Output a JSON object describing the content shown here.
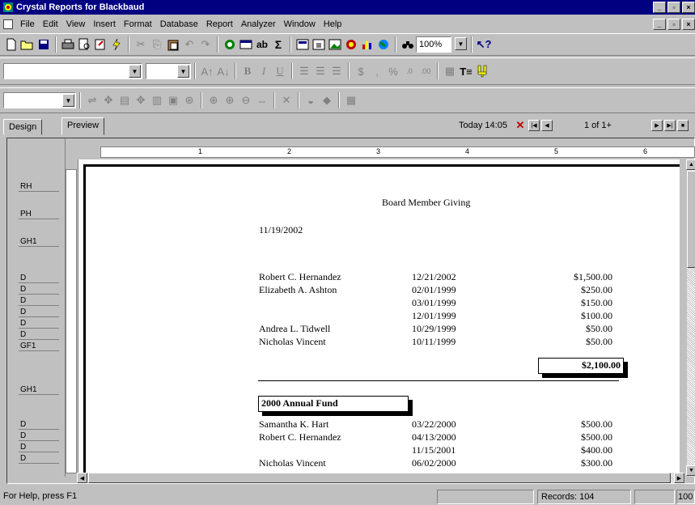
{
  "window": {
    "title": "Crystal Reports for Blackbaud",
    "min": "_",
    "max": "▫",
    "close": "×"
  },
  "menu": [
    "File",
    "Edit",
    "View",
    "Insert",
    "Format",
    "Database",
    "Report",
    "Analyzer",
    "Window",
    "Help"
  ],
  "toolbar1": {
    "zoom_value": "100%"
  },
  "tabs": {
    "design": "Design",
    "preview": "Preview"
  },
  "nav": {
    "today": "Today 14:05",
    "page": "1 of 1+"
  },
  "sections": [
    "RH",
    "PH",
    "GH1",
    "D",
    "D",
    "D",
    "D",
    "D",
    "D",
    "GF1",
    "GH1",
    "D",
    "D",
    "D",
    "D"
  ],
  "ruler_marks": [
    "1",
    "2",
    "3",
    "4",
    "5",
    "6"
  ],
  "report": {
    "title": "Board Member Giving",
    "date": "11/19/2002",
    "group1_rows": [
      {
        "name": "Robert C. Hernandez",
        "date": "12/21/2002",
        "amount": "$1,500.00"
      },
      {
        "name": "Elizabeth A. Ashton",
        "date": "02/01/1999",
        "amount": "$250.00"
      },
      {
        "name": "",
        "date": "03/01/1999",
        "amount": "$150.00"
      },
      {
        "name": "",
        "date": "12/01/1999",
        "amount": "$100.00"
      },
      {
        "name": "Andrea L. Tidwell",
        "date": "10/29/1999",
        "amount": "$50.00"
      },
      {
        "name": "Nicholas Vincent",
        "date": "10/11/1999",
        "amount": "$50.00"
      }
    ],
    "group1_total": "$2,100.00",
    "group2_title": "2000 Annual Fund",
    "group2_rows": [
      {
        "name": "Samantha K. Hart",
        "date": "03/22/2000",
        "amount": "$500.00"
      },
      {
        "name": "Robert C. Hernandez",
        "date": "04/13/2000",
        "amount": "$500.00"
      },
      {
        "name": "",
        "date": "11/15/2001",
        "amount": "$400.00"
      },
      {
        "name": "Nicholas Vincent",
        "date": "06/02/2000",
        "amount": "$300.00"
      }
    ]
  },
  "status": {
    "help": "For Help, press F1",
    "records": "Records: 104",
    "zoom": "100"
  }
}
